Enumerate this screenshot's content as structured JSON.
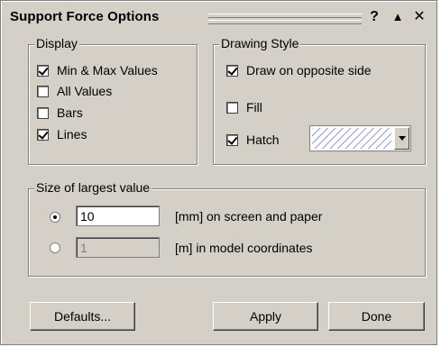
{
  "window": {
    "title": "Support Force Options",
    "help_label": "?",
    "rollup_label": "▲",
    "close_label": "✕"
  },
  "display": {
    "legend": "Display",
    "items": [
      {
        "label": "Min & Max Values",
        "checked": true
      },
      {
        "label": "All Values",
        "checked": false
      },
      {
        "label": "Bars",
        "checked": false
      },
      {
        "label": "Lines",
        "checked": true
      }
    ]
  },
  "drawing_style": {
    "legend": "Drawing Style",
    "items": [
      {
        "label": "Draw on opposite side",
        "checked": true
      },
      {
        "label": "Fill",
        "checked": false
      },
      {
        "label": "Hatch",
        "checked": true
      }
    ],
    "hatch_color": "#6060c0"
  },
  "size": {
    "legend": "Size of largest value",
    "options": [
      {
        "value": "10",
        "unit_label": "[mm] on screen and paper",
        "selected": true,
        "enabled": true
      },
      {
        "value": "1",
        "unit_label": "[m] in model coordinates",
        "selected": false,
        "enabled": false
      }
    ]
  },
  "buttons": {
    "defaults": "Defaults...",
    "apply": "Apply",
    "done": "Done"
  }
}
